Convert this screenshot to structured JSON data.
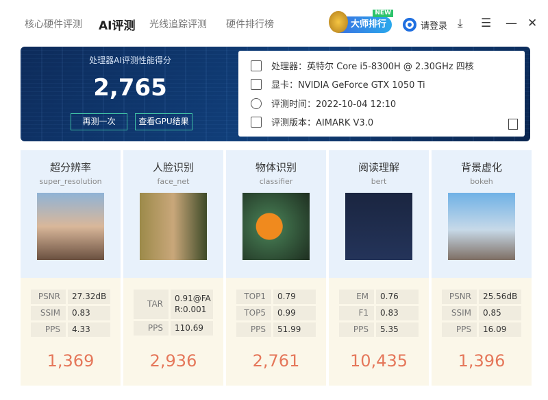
{
  "nav": {
    "tabs": [
      "核心硬件评测",
      "AI评测",
      "光线追踪评测",
      "硬件排行榜"
    ],
    "master_rank": "大师排行",
    "new_badge": "NEW",
    "login": "请登录"
  },
  "banner": {
    "title": "处理器AI评测性能得分",
    "score": "2,765",
    "retest": "再测一次",
    "view_gpu": "查看GPU结果"
  },
  "info": {
    "cpu": "处理器：英特尔 Core i5-8300H @ 2.30GHz 四核",
    "gpu": "显卡：NVIDIA GeForce GTX 1050 Ti",
    "time": "评测时间：2022-10-04 12:10",
    "version": "评测版本：AIMARK V3.0"
  },
  "cards": [
    {
      "name": "超分辨率",
      "en": "super_resolution",
      "metrics": [
        [
          "PSNR",
          "27.32dB"
        ],
        [
          "SSIM",
          "0.83"
        ],
        [
          "PPS",
          "4.33"
        ]
      ],
      "score": "1,369"
    },
    {
      "name": "人脸识别",
      "en": "face_net",
      "metrics": [
        [
          "TAR",
          "0.91@FAR:0.001"
        ],
        [
          "PPS",
          "110.69"
        ]
      ],
      "score": "2,936"
    },
    {
      "name": "物体识别",
      "en": "classifier",
      "metrics": [
        [
          "TOP1",
          "0.79"
        ],
        [
          "TOP5",
          "0.99"
        ],
        [
          "PPS",
          "51.99"
        ]
      ],
      "score": "2,761"
    },
    {
      "name": "阅读理解",
      "en": "bert",
      "metrics": [
        [
          "EM",
          "0.76"
        ],
        [
          "F1",
          "0.83"
        ],
        [
          "PPS",
          "5.35"
        ]
      ],
      "score": "10,435"
    },
    {
      "name": "背景虚化",
      "en": "bokeh",
      "metrics": [
        [
          "PSNR",
          "25.56dB"
        ],
        [
          "SSIM",
          "0.85"
        ],
        [
          "PPS",
          "16.09"
        ]
      ],
      "score": "1,396"
    }
  ]
}
